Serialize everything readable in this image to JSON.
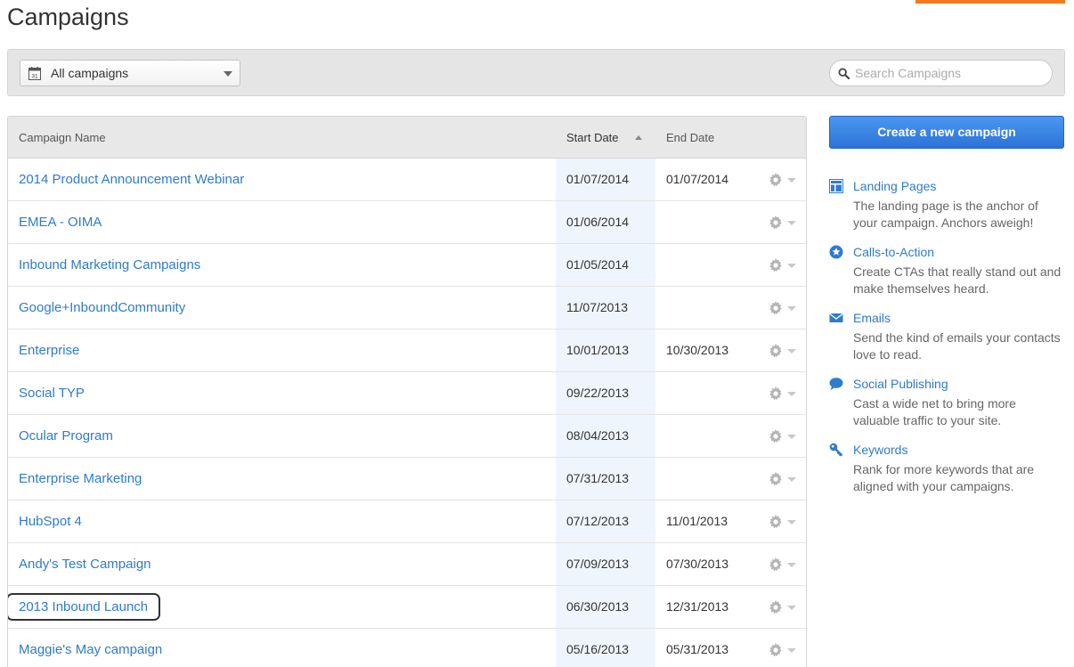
{
  "page": {
    "title": "Campaigns"
  },
  "filter": {
    "selected": "All campaigns",
    "calendar_day": "31"
  },
  "search": {
    "placeholder": "Search Campaigns",
    "value": ""
  },
  "table": {
    "columns": {
      "name": "Campaign Name",
      "start": "Start Date",
      "end": "End Date"
    },
    "sort": {
      "column": "Start Date",
      "direction": "descending"
    },
    "rows": [
      {
        "name": "2014 Product Announcement Webinar",
        "start": "01/07/2014",
        "end": "01/07/2014"
      },
      {
        "name": "EMEA - OIMA",
        "start": "01/06/2014",
        "end": ""
      },
      {
        "name": "Inbound Marketing Campaigns",
        "start": "01/05/2014",
        "end": ""
      },
      {
        "name": "Google+InboundCommunity",
        "start": "11/07/2013",
        "end": ""
      },
      {
        "name": "Enterprise",
        "start": "10/01/2013",
        "end": "10/30/2013"
      },
      {
        "name": "Social TYP",
        "start": "09/22/2013",
        "end": ""
      },
      {
        "name": "Ocular Program",
        "start": "08/04/2013",
        "end": ""
      },
      {
        "name": "Enterprise Marketing",
        "start": "07/31/2013",
        "end": ""
      },
      {
        "name": "HubSpot 4",
        "start": "07/12/2013",
        "end": "11/01/2013"
      },
      {
        "name": "Andy's Test Campaign",
        "start": "07/09/2013",
        "end": "07/30/2013"
      },
      {
        "name": "2013 Inbound Launch",
        "start": "06/30/2013",
        "end": "12/31/2013"
      },
      {
        "name": "Maggie's May campaign",
        "start": "05/16/2013",
        "end": "05/31/2013"
      }
    ]
  },
  "sidebar": {
    "create_button": "Create a new campaign",
    "items": [
      {
        "icon": "landing-page-icon",
        "label": "Landing Pages",
        "desc": "The landing page is the anchor of your campaign. Anchors aweigh!"
      },
      {
        "icon": "star-icon",
        "label": "Calls-to-Action",
        "desc": "Create CTAs that really stand out and make themselves heard."
      },
      {
        "icon": "envelope-icon",
        "label": "Emails",
        "desc": "Send the kind of emails your contacts love to read."
      },
      {
        "icon": "speech-bubble-icon",
        "label": "Social Publishing",
        "desc": "Cast a wide net to bring more valuable traffic to your site."
      },
      {
        "icon": "key-icon",
        "label": "Keywords",
        "desc": "Rank for more keywords that are aligned with your campaigns."
      }
    ]
  },
  "colors": {
    "accent": "#2e7bcf",
    "button": "#3a86e4",
    "orange": "#f57722",
    "highlight_col": "#eef5fd"
  }
}
